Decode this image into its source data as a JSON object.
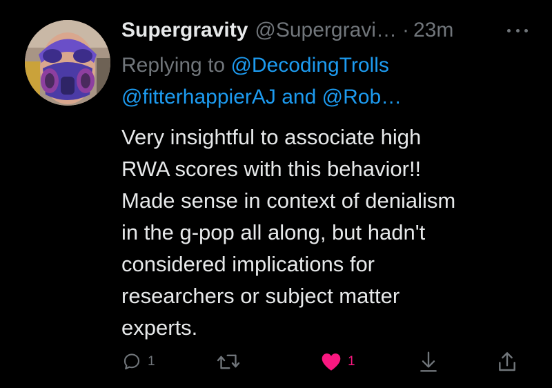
{
  "tweet": {
    "display_name": "Supergravity",
    "handle": "@Supergravi…",
    "separator": "·",
    "time": "23m",
    "more_icon": "more-horizontal-icon",
    "replying_prefix": "Replying to",
    "mention_1": "@DecodingTrolls",
    "mention_2": "@fitterhappierAJ",
    "mention_joiner": "and",
    "mention_3": "@Rob…",
    "body_lines": [
      "Very insightful to associate high",
      "RWA scores with this behavior!!",
      "Made sense in context of denialism",
      "in the g-pop all along, but hadn't",
      "considered implications for",
      "researchers or subject matter",
      "experts."
    ]
  },
  "actions": {
    "reply": {
      "icon": "reply-bubble-icon",
      "count": "1"
    },
    "retweet": {
      "icon": "retweet-icon",
      "count": ""
    },
    "like": {
      "icon": "heart-icon",
      "count": "1",
      "liked": true
    },
    "bookmark": {
      "icon": "download-arrow-icon"
    },
    "share": {
      "icon": "share-icon"
    }
  },
  "colors": {
    "background": "#000000",
    "text": "#e7e9ea",
    "muted": "#71767b",
    "link": "#1d9bf0",
    "like": "#f91880"
  }
}
